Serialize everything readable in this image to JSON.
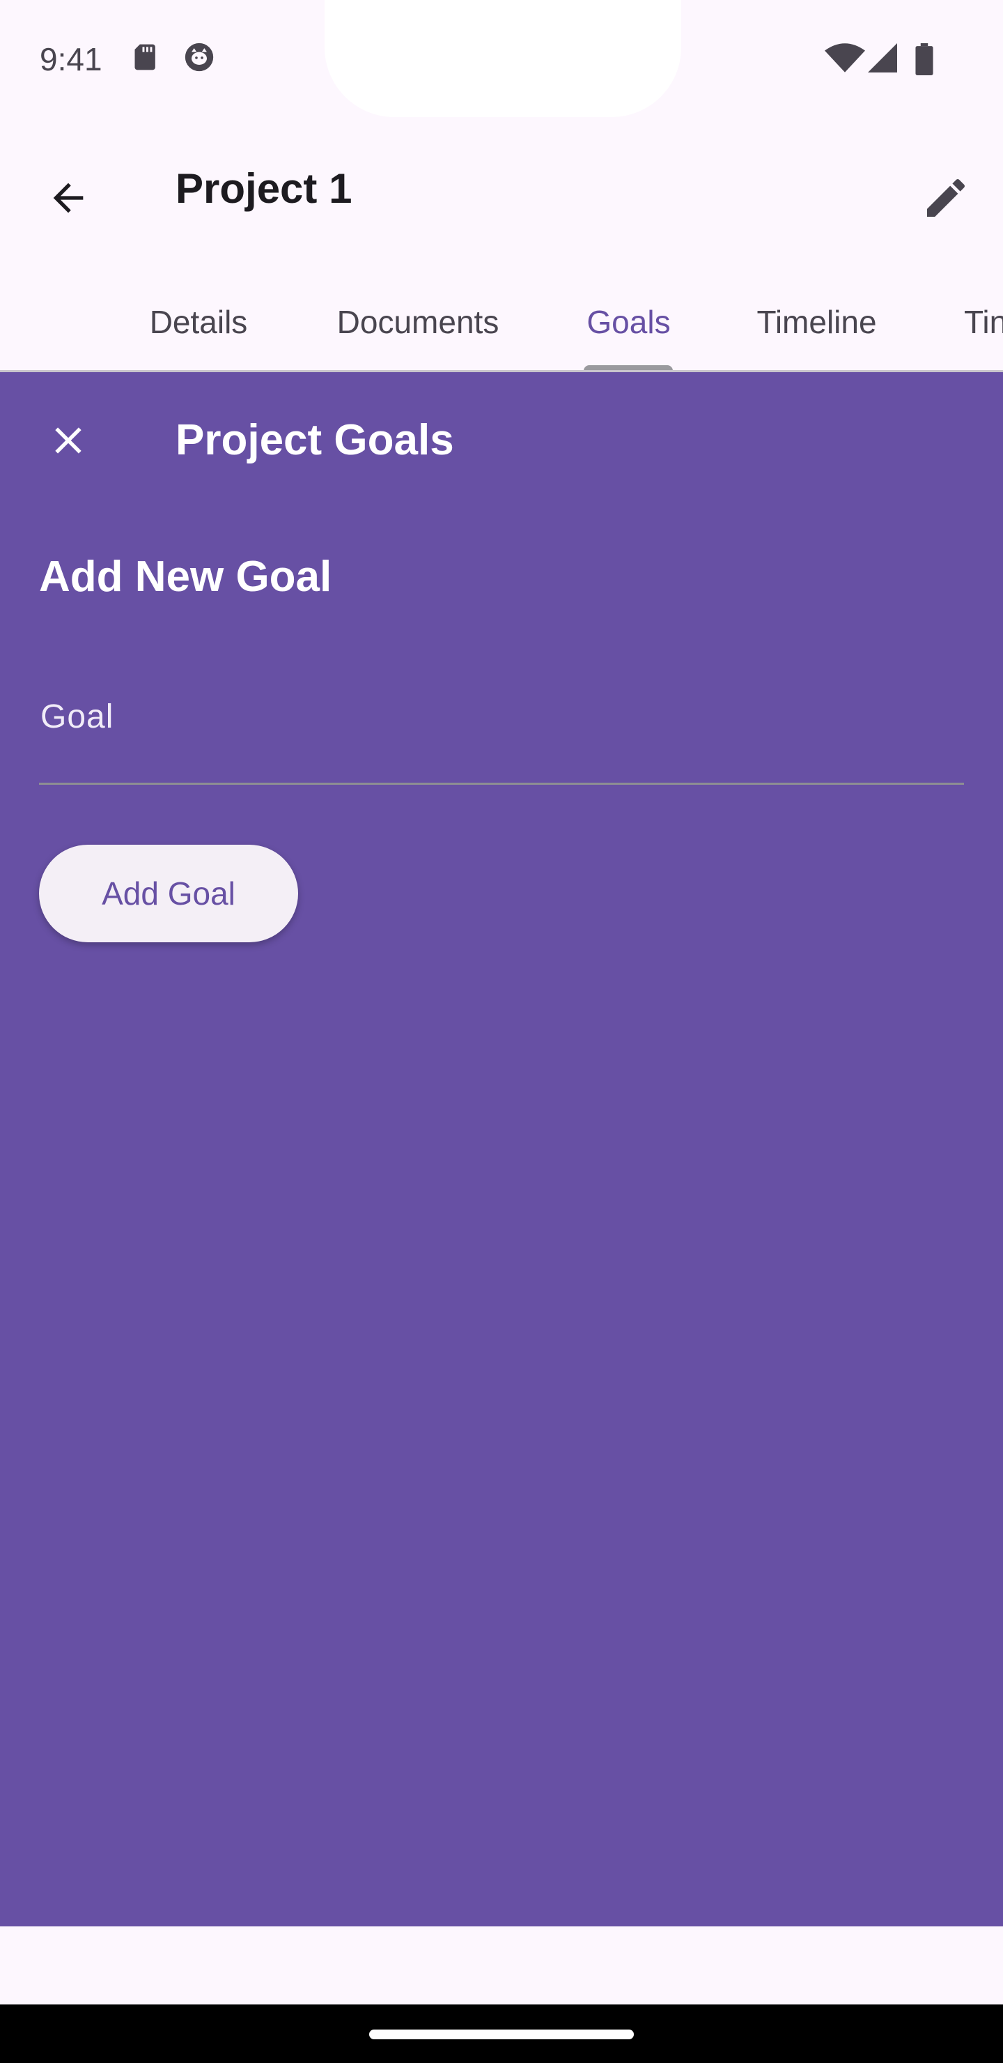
{
  "status_bar": {
    "time": "9:41",
    "icons": [
      "sd-card-icon",
      "cat-icon",
      "wifi-icon",
      "signal-icon",
      "battery-icon"
    ]
  },
  "app_bar": {
    "back_icon": "arrow-back-icon",
    "title": "Project 1",
    "edit_icon": "pencil-icon"
  },
  "tabs": [
    {
      "label": "Details",
      "active": false
    },
    {
      "label": "Documents",
      "active": false
    },
    {
      "label": "Goals",
      "active": true
    },
    {
      "label": "Timeline",
      "active": false
    },
    {
      "label": "Tin",
      "active": false
    }
  ],
  "sheet": {
    "close_icon": "close-icon",
    "title": "Project Goals",
    "section_heading": "Add New Goal",
    "goal_field": {
      "placeholder": "Goal",
      "value": ""
    },
    "add_button_label": "Add Goal"
  },
  "colors": {
    "primary": "#6750a4",
    "surface": "#fdf7fe",
    "on_primary": "#ffffff",
    "button_surface": "#f4eff6"
  }
}
